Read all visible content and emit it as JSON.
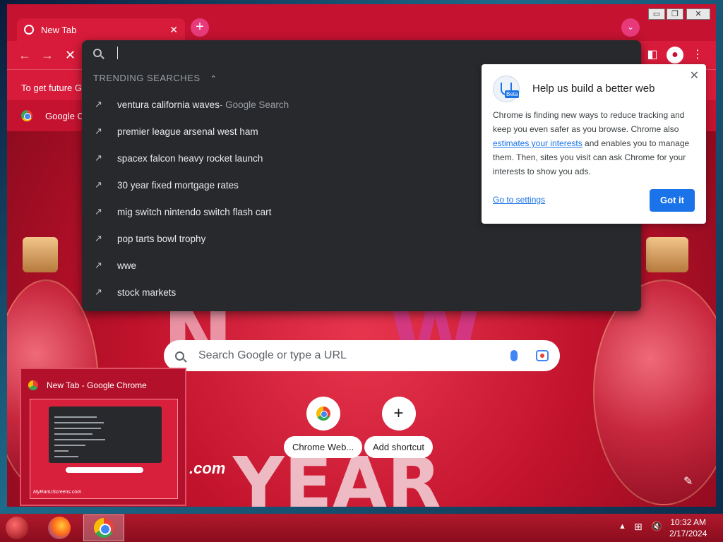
{
  "browser": {
    "tab_title": "New Tab",
    "tab_close": "✕",
    "new_tab": "+",
    "tab_search": "⌄",
    "win_minimize": "▭",
    "win_restore": "❐",
    "win_close": "✕",
    "back": "←",
    "forward": "→",
    "stop": "✕",
    "sidepanel": "◧",
    "profile": "●",
    "menu": "⋮",
    "infobar_text": "To get future G",
    "bookmark_label": "Google C"
  },
  "omnibox": {
    "section_title": "TRENDING SEARCHES",
    "section_chevron": "⌃",
    "trend_icon": "↗",
    "suggestions": [
      {
        "text": "ventura california waves",
        "extra": " - Google Search"
      },
      {
        "text": "premier league arsenal west ham",
        "extra": ""
      },
      {
        "text": "spacex falcon heavy rocket launch",
        "extra": ""
      },
      {
        "text": "30 year fixed mortgage rates",
        "extra": ""
      },
      {
        "text": "mig switch nintendo switch flash cart",
        "extra": ""
      },
      {
        "text": "pop tarts bowl trophy",
        "extra": ""
      },
      {
        "text": "wwe",
        "extra": ""
      },
      {
        "text": "stock markets",
        "extra": ""
      }
    ]
  },
  "bubble": {
    "badge": "Beta",
    "title": "Help us build a better web",
    "body_1": "Chrome is finding new ways to reduce tracking and keep you even safer as you browse. Chrome also ",
    "body_link": "estimates your interests",
    "body_2": " and enables you to manage them. Then, sites you visit can ask Chrome for your interests to show you ads.",
    "settings_link": "Go to settings",
    "got_it": "Got it",
    "close": "✕"
  },
  "ntp": {
    "search_placeholder": "Search Google or type a URL",
    "shortcuts": [
      {
        "label": "Chrome Web..."
      },
      {
        "label": "Add shortcut",
        "icon": "+"
      }
    ],
    "background_text": ".com",
    "customize_icon": "✎"
  },
  "thumbnail": {
    "title": "New Tab - Google Chrome",
    "site_text": "MyRanUScreens.com"
  },
  "taskbar": {
    "tray_up": "▲",
    "network": "⊞",
    "volume": "🔇",
    "time": "10:32 AM",
    "date": "2/17/2024"
  }
}
